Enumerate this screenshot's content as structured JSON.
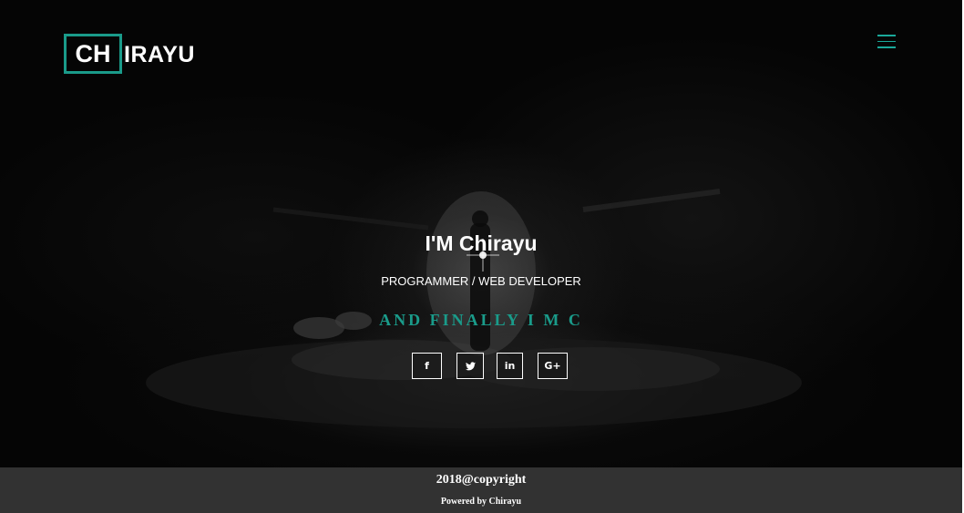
{
  "header": {
    "logo_boxed": "CH",
    "logo_rest": "IRAYU",
    "menu_icon": "hamburger-menu-icon"
  },
  "hero": {
    "title": "I'M Chirayu",
    "subtitle": "PROGRAMMER / WEB DEVELOPER",
    "typed_text": "AND FINALLY I M C"
  },
  "socials": [
    {
      "name": "facebook",
      "icon": "facebook-icon",
      "glyph": "f"
    },
    {
      "name": "twitter",
      "icon": "twitter-icon",
      "glyph": "t"
    },
    {
      "name": "linkedin",
      "icon": "linkedin-icon",
      "glyph": "in"
    },
    {
      "name": "google-plus",
      "icon": "google-plus-icon",
      "glyph": "G+"
    }
  ],
  "footer": {
    "copyright": "2018@copyright",
    "powered_by": "Powered by Chirayu"
  },
  "colors": {
    "accent": "#1a9b8a",
    "footer_bg": "#323232",
    "hero_bg": "#050505",
    "text": "#ffffff"
  }
}
